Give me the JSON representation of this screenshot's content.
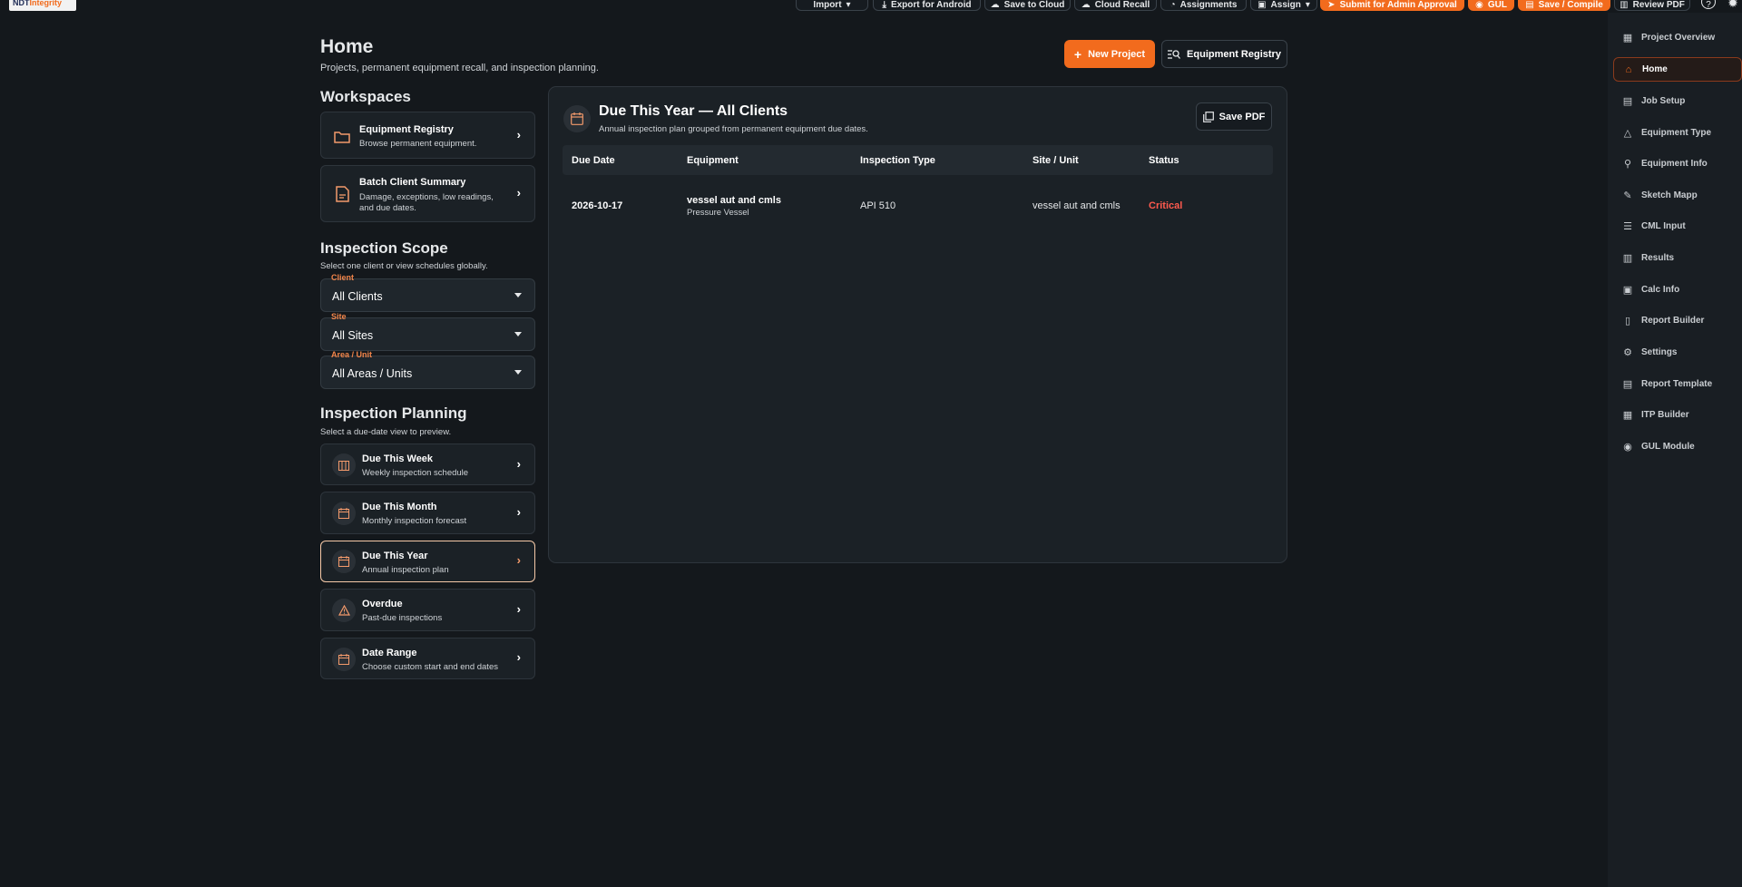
{
  "toolbar": {
    "logo_a": "NDT",
    "logo_b": "Integrity",
    "buttons": [
      {
        "label": "Import",
        "icon": "chevron-down-icon"
      },
      {
        "label": "Export for Android",
        "icon": "download-icon"
      },
      {
        "label": "Save to Cloud",
        "icon": "cloud-upload-icon"
      },
      {
        "label": "Cloud Recall",
        "icon": "cloud-download-icon"
      },
      {
        "label": "Assignments",
        "icon": "bell-icon"
      },
      {
        "label": "Assign",
        "icon": "chevron-down-icon"
      },
      {
        "label": "Submit for Admin Approval",
        "icon": "send-icon"
      },
      {
        "label": "GUL",
        "icon": "signal-icon"
      },
      {
        "label": "Save / Compile",
        "icon": "save-icon"
      },
      {
        "label": "Review PDF",
        "icon": "pdf-icon"
      }
    ]
  },
  "header": {
    "title": "Home",
    "subtitle": "Projects, permanent equipment recall, and inspection planning.",
    "new_project": "New Project",
    "equipment_registry": "Equipment Registry"
  },
  "workspaces": {
    "title": "Workspaces",
    "items": [
      {
        "title": "Equipment Registry",
        "desc": "Browse permanent equipment.",
        "icon": "folder-icon"
      },
      {
        "title": "Batch Client Summary",
        "desc": "Damage, exceptions, low readings, and due dates.",
        "icon": "document-icon"
      }
    ]
  },
  "scope": {
    "title": "Inspection Scope",
    "subtitle": "Select one client or view schedules globally.",
    "client_label": "Client",
    "client_value": "All Clients",
    "site_label": "Site",
    "site_value": "All Sites",
    "area_label": "Area / Unit",
    "area_value": "All Areas / Units"
  },
  "planning": {
    "title": "Inspection Planning",
    "subtitle": "Select a due-date view to preview.",
    "items": [
      {
        "title": "Due This Week",
        "desc": "Weekly inspection schedule",
        "icon": "calendar-week-icon"
      },
      {
        "title": "Due This Month",
        "desc": "Monthly inspection forecast",
        "icon": "calendar-icon"
      },
      {
        "title": "Due This Year",
        "desc": "Annual inspection plan",
        "icon": "calendar-icon",
        "active": true
      },
      {
        "title": "Overdue",
        "desc": "Past-due inspections",
        "icon": "warning-icon"
      },
      {
        "title": "Date Range",
        "desc": "Choose custom start and end dates",
        "icon": "calendar-icon"
      }
    ]
  },
  "panel": {
    "title": "Due This Year — All Clients",
    "subtitle": "Annual inspection plan grouped from permanent equipment due dates.",
    "save_pdf": "Save PDF",
    "columns": [
      "Due Date",
      "Equipment",
      "Inspection Type",
      "Site / Unit",
      "Status"
    ],
    "rows": [
      {
        "due_date": "2026-10-17",
        "equipment": "vessel aut and cmls",
        "equipment_type": "Pressure Vessel",
        "inspection_type": "API 510",
        "site_unit": "vessel aut and cmls",
        "status": "Critical"
      }
    ]
  },
  "nav": {
    "items": [
      {
        "label": "Project Overview",
        "icon": "grid-icon"
      },
      {
        "label": "Home",
        "icon": "home-icon",
        "active": true
      },
      {
        "label": "Job Setup",
        "icon": "clipboard-icon"
      },
      {
        "label": "Equipment Type",
        "icon": "shapes-icon"
      },
      {
        "label": "Equipment Info",
        "icon": "crane-icon"
      },
      {
        "label": "Sketch Mapp",
        "icon": "pen-icon"
      },
      {
        "label": "CML Input",
        "icon": "list-icon"
      },
      {
        "label": "Results",
        "icon": "chart-icon"
      },
      {
        "label": "Calc Info",
        "icon": "calculator-icon"
      },
      {
        "label": "Report Builder",
        "icon": "file-icon"
      },
      {
        "label": "Settings",
        "icon": "gear-icon"
      },
      {
        "label": "Report Template",
        "icon": "template-icon"
      },
      {
        "label": "ITP Builder",
        "icon": "blocks-icon"
      },
      {
        "label": "GUL Module",
        "icon": "signal-icon"
      }
    ]
  },
  "colors": {
    "accent": "#f26b1d",
    "critical": "#ff5a4e",
    "background": "#14181c"
  }
}
